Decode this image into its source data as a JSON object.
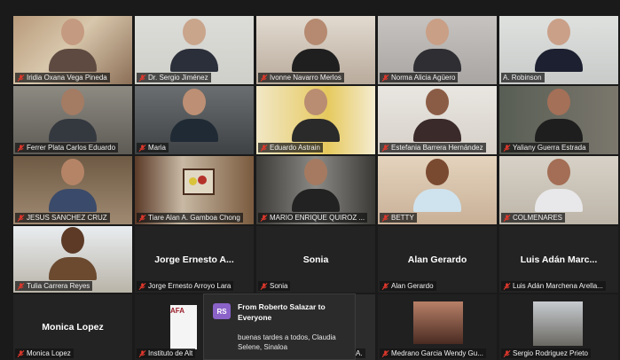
{
  "meeting": {
    "participants": [
      {
        "name": "Iridia Oxana Vega Pineda",
        "video": true,
        "muted": true
      },
      {
        "name": "Dr. Sergio Jiménez",
        "video": true,
        "muted": true
      },
      {
        "name": "Ivonne Navarro Merlos",
        "video": true,
        "muted": true
      },
      {
        "name": "Norma Alicia Agüero",
        "video": true,
        "muted": true
      },
      {
        "name": "A. Robinson",
        "video": true,
        "muted": false,
        "active_speaker": true
      },
      {
        "name": "Ferrer Plata Carlos Eduardo",
        "video": true,
        "muted": true
      },
      {
        "name": "Maria",
        "video": true,
        "muted": true
      },
      {
        "name": "Eduardo Astrain",
        "video": true,
        "muted": true
      },
      {
        "name": "Estefania Barrera Hernández",
        "video": true,
        "muted": true
      },
      {
        "name": "Yaliany Guerra Estrada",
        "video": true,
        "muted": true
      },
      {
        "name": "JESUS SANCHEZ CRUZ",
        "video": true,
        "muted": true
      },
      {
        "name": "Tiare Alan A. Gamboa Chong",
        "video": true,
        "muted": true
      },
      {
        "name": "MARIO ENRIQUE QUIROZ ...",
        "video": true,
        "muted": true
      },
      {
        "name": "BETTY",
        "video": true,
        "muted": true
      },
      {
        "name": "COLMENARES",
        "video": true,
        "muted": true
      },
      {
        "name": "Tulia Carrera Reyes",
        "video": true,
        "muted": true
      },
      {
        "name": "Jorge Ernesto Arroyo Lara",
        "display": "Jorge Ernesto A...",
        "video": false,
        "muted": true
      },
      {
        "name": "Sonia",
        "display": "Sonia",
        "video": false,
        "muted": true
      },
      {
        "name": "Alan Gerardo",
        "display": "Alan Gerardo",
        "video": false,
        "muted": true
      },
      {
        "name": "Luis Adán Marchena Arella...",
        "display": "Luis Adán Marc...",
        "video": false,
        "muted": true
      },
      {
        "name": "Monica Lopez",
        "display": "Monica Lopez",
        "video": false,
        "muted": true
      },
      {
        "name": "Instituto de Alt",
        "video": true,
        "muted": true
      },
      {
        "name": "A.",
        "video": true,
        "muted": true
      },
      {
        "name": "Medrano Garcia Wendy Gu...",
        "video": true,
        "muted": true
      },
      {
        "name": "Sergio Rodriguez Prieto",
        "video": true,
        "muted": true
      }
    ]
  },
  "chat_popup": {
    "avatar_initials": "RS",
    "header": "From Roberto Salazar to Everyone",
    "message": "buenas tardes a todos, Claudia Selene, Sinaloa"
  },
  "logo_text": "AFA",
  "colors": {
    "active_speaker_border": "#e8e34a",
    "muted_icon": "#e0382c",
    "chat_avatar": "#8a62c8"
  }
}
